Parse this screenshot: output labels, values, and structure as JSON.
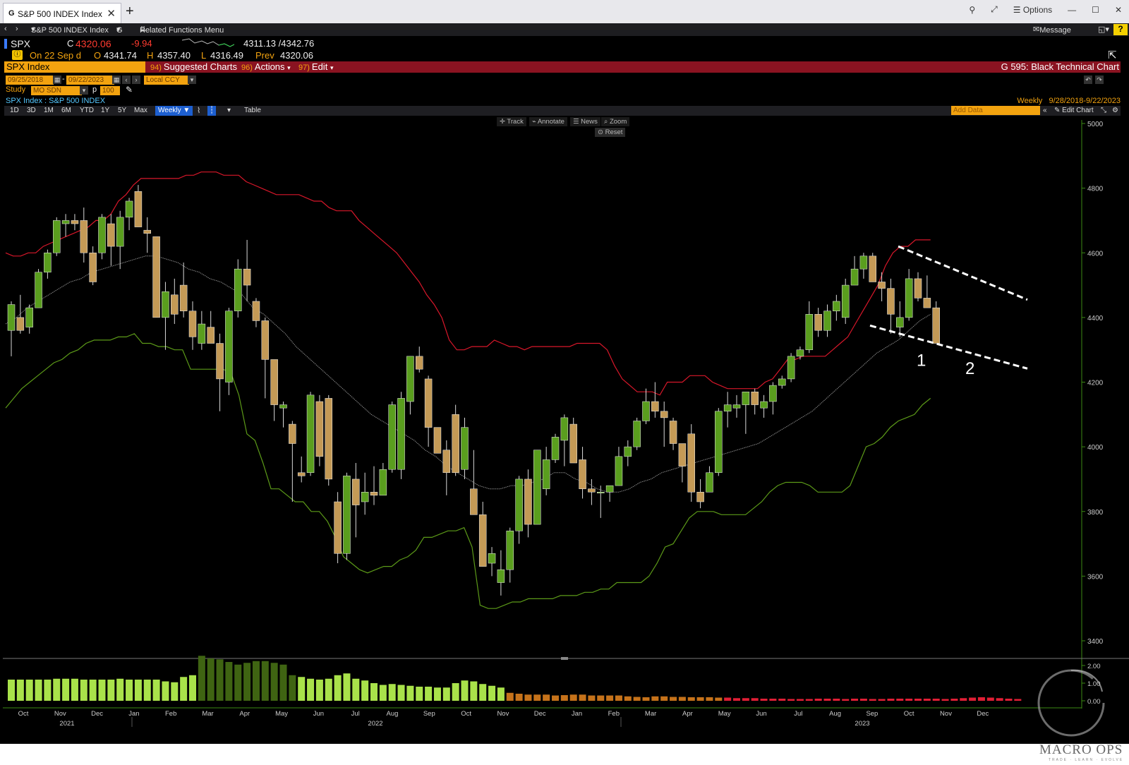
{
  "window": {
    "tab_title": "S&P 500 INDEX Index",
    "tab_prefix": "G",
    "options_label": "Options"
  },
  "navbar": {
    "security": "S&P 500 INDEX Index",
    "g_menu": "G",
    "related": "Related Functions Menu",
    "message": "Message",
    "help": "?"
  },
  "quote": {
    "ticker": "SPX",
    "close_prefix": "C",
    "close": "4320.06",
    "change": "-9.94",
    "range": "4311.13 /4342.76",
    "date_line": "On 22 Sep d",
    "open_prefix": "O",
    "open": "4341.74",
    "high_prefix": "H",
    "high": "4357.40",
    "low_prefix": "L",
    "low": "4316.49",
    "prev_prefix": "Prev",
    "prev": "4320.06"
  },
  "function_bar": {
    "security": "SPX Index",
    "suggested": {
      "num": "94)",
      "label": "Suggested Charts"
    },
    "actions": {
      "num": "96)",
      "label": "Actions"
    },
    "edit": {
      "num": "97)",
      "label": "Edit"
    },
    "chart_name": "G 595: Black Technical Chart"
  },
  "controls": {
    "start_date": "09/25/2018",
    "end_date": "09/22/2023",
    "currency": "Local CCY",
    "study_label": "Study",
    "study_value": "MO SDN",
    "p_label": "p",
    "p_value": "100",
    "chart_title": "SPX Index : S&P 500 INDEX",
    "frequency_label": "Weekly",
    "date_range": "9/28/2018-9/22/2023",
    "periods": [
      "1D",
      "3D",
      "1M",
      "6M",
      "YTD",
      "1Y",
      "5Y",
      "Max"
    ],
    "frequency_button": "Weekly",
    "table_label": "Table",
    "add_data_placeholder": "Add Data",
    "edit_chart": "Edit Chart",
    "tools": [
      "Track",
      "Annotate",
      "News",
      "Zoom"
    ],
    "reset": "Reset"
  },
  "annotations": {
    "label1": "1",
    "label2": "2"
  },
  "branding": {
    "logo_text": "MACRO OPS",
    "logo_sub": "TRADE · LEARN · EVOLVE"
  },
  "chart_data": {
    "type": "candlestick",
    "frequency": "Weekly",
    "y_axis": {
      "ticks": [
        3400,
        3600,
        3800,
        4000,
        4200,
        4400,
        4600,
        4800,
        5000
      ],
      "range": [
        3400,
        5020
      ],
      "side": "right"
    },
    "volume_axis": {
      "ticks": [
        "0.00",
        "1.00",
        "2.00"
      ],
      "range": [
        0,
        2.6
      ]
    },
    "x_axis": {
      "months": [
        "Oct",
        "Nov",
        "Dec",
        "Jan",
        "Feb",
        "Mar",
        "Apr",
        "May",
        "Jun",
        "Jul",
        "Aug",
        "Sep",
        "Oct",
        "Nov",
        "Dec",
        "Jan",
        "Feb",
        "Mar",
        "Apr",
        "May",
        "Jun",
        "Jul",
        "Aug",
        "Sep",
        "Oct",
        "Nov",
        "Dec"
      ],
      "years": [
        "2021",
        "2022",
        "2023"
      ]
    },
    "colors": {
      "up": "#5a9e1e",
      "down": "#c49a56",
      "upper_band": "#d8172a",
      "lower_band": "#5c9a18",
      "mid_line": "#8a8a8a",
      "vol_up": "#a9e24a",
      "vol_up_dark": "#3f6412",
      "vol_orange": "#c5721a",
      "vol_red": "#e01f35",
      "axis": "#3c8a14"
    },
    "candles": [
      [
        4360,
        4450,
        4280,
        4440
      ],
      [
        4400,
        4470,
        4350,
        4360
      ],
      [
        4370,
        4440,
        4350,
        4430
      ],
      [
        4430,
        4550,
        4430,
        4540
      ],
      [
        4540,
        4610,
        4520,
        4600
      ],
      [
        4600,
        4710,
        4590,
        4700
      ],
      [
        4690,
        4720,
        4650,
        4700
      ],
      [
        4700,
        4720,
        4670,
        4690
      ],
      [
        4700,
        4740,
        4570,
        4600
      ],
      [
        4600,
        4620,
        4500,
        4510
      ],
      [
        4600,
        4720,
        4580,
        4710
      ],
      [
        4690,
        4720,
        4560,
        4620
      ],
      [
        4620,
        4730,
        4550,
        4710
      ],
      [
        4710,
        4770,
        4670,
        4760
      ],
      [
        4790,
        4810,
        4680,
        4680
      ],
      [
        4670,
        4710,
        4600,
        4660
      ],
      [
        4650,
        4610,
        4400,
        4400
      ],
      [
        4400,
        4510,
        4300,
        4480
      ],
      [
        4470,
        4520,
        4380,
        4410
      ],
      [
        4500,
        4570,
        4400,
        4420
      ],
      [
        4420,
        4450,
        4300,
        4340
      ],
      [
        4320,
        4420,
        4300,
        4380
      ],
      [
        4370,
        4420,
        4330,
        4320
      ],
      [
        4320,
        4350,
        4110,
        4210
      ],
      [
        4200,
        4430,
        4160,
        4420
      ],
      [
        4420,
        4580,
        4400,
        4550
      ],
      [
        4550,
        4640,
        4450,
        4500
      ],
      [
        4450,
        4460,
        4370,
        4390
      ],
      [
        4390,
        4400,
        4150,
        4270
      ],
      [
        4270,
        4250,
        4080,
        4130
      ],
      [
        4120,
        4140,
        4060,
        4130
      ],
      [
        4070,
        4080,
        3830,
        4010
      ],
      [
        3920,
        3970,
        3890,
        3910
      ],
      [
        3920,
        4170,
        3910,
        4160
      ],
      [
        4140,
        4160,
        3940,
        3970
      ],
      [
        4150,
        4160,
        3880,
        3900
      ],
      [
        3830,
        3860,
        3640,
        3670
      ],
      [
        3670,
        3920,
        3650,
        3910
      ],
      [
        3900,
        3950,
        3720,
        3820
      ],
      [
        3830,
        3920,
        3790,
        3860
      ],
      [
        3860,
        3940,
        3820,
        3850
      ],
      [
        3850,
        3950,
        3850,
        3930
      ],
      [
        3930,
        4140,
        3920,
        4130
      ],
      [
        3930,
        4170,
        3900,
        4150
      ],
      [
        4140,
        4280,
        4100,
        4280
      ],
      [
        4280,
        4310,
        4230,
        4240
      ],
      [
        4210,
        4220,
        4000,
        4060
      ],
      [
        4060,
        4040,
        3990,
        3980
      ],
      [
        3990,
        4020,
        3850,
        3920
      ],
      [
        4100,
        4130,
        3910,
        3920
      ],
      [
        3930,
        4090,
        3900,
        4060
      ],
      [
        3870,
        3990,
        3800,
        3790
      ],
      [
        3790,
        3830,
        3630,
        3630
      ],
      [
        3640,
        3690,
        3600,
        3670
      ],
      [
        3580,
        3680,
        3540,
        3620
      ],
      [
        3620,
        3750,
        3580,
        3740
      ],
      [
        3740,
        3910,
        3700,
        3900
      ],
      [
        3900,
        3930,
        3720,
        3760
      ],
      [
        3760,
        3990,
        3760,
        3990
      ],
      [
        3870,
        4000,
        3850,
        3960
      ],
      [
        3960,
        4040,
        3950,
        4030
      ],
      [
        4020,
        4100,
        3940,
        4090
      ],
      [
        4070,
        4090,
        3980,
        3950
      ],
      [
        3960,
        4000,
        3840,
        3870
      ],
      [
        3870,
        3900,
        3820,
        3860
      ],
      [
        3860,
        3880,
        3780,
        3860
      ],
      [
        3860,
        3870,
        3830,
        3880
      ],
      [
        3880,
        4000,
        3880,
        3970
      ],
      [
        3970,
        4020,
        3940,
        4000
      ],
      [
        4000,
        4090,
        3990,
        4080
      ],
      [
        4080,
        4180,
        4070,
        4140
      ],
      [
        4140,
        4200,
        4090,
        4110
      ],
      [
        4110,
        4140,
        4000,
        4090
      ],
      [
        4080,
        4090,
        3990,
        4010
      ],
      [
        4010,
        3950,
        3890,
        3940
      ],
      [
        4040,
        4070,
        3830,
        3860
      ],
      [
        3860,
        3900,
        3810,
        3830
      ],
      [
        3860,
        3940,
        3860,
        3920
      ],
      [
        3920,
        4120,
        3910,
        4110
      ],
      [
        4110,
        4170,
        4060,
        4130
      ],
      [
        4120,
        4160,
        4090,
        4130
      ],
      [
        4130,
        4170,
        4040,
        4170
      ],
      [
        4170,
        4180,
        4100,
        4130
      ],
      [
        4120,
        4160,
        4090,
        4140
      ],
      [
        4140,
        4200,
        4100,
        4190
      ],
      [
        4190,
        4220,
        4180,
        4210
      ],
      [
        4210,
        4290,
        4200,
        4280
      ],
      [
        4280,
        4310,
        4270,
        4300
      ],
      [
        4300,
        4450,
        4290,
        4410
      ],
      [
        4410,
        4430,
        4340,
        4360
      ],
      [
        4360,
        4440,
        4340,
        4420
      ],
      [
        4420,
        4470,
        4390,
        4450
      ],
      [
        4400,
        4520,
        4380,
        4500
      ],
      [
        4500,
        4590,
        4500,
        4550
      ],
      [
        4550,
        4600,
        4520,
        4590
      ],
      [
        4590,
        4600,
        4510,
        4510
      ],
      [
        4510,
        4540,
        4450,
        4490
      ],
      [
        4490,
        4520,
        4350,
        4410
      ],
      [
        4370,
        4450,
        4340,
        4400
      ],
      [
        4400,
        4550,
        4390,
        4520
      ],
      [
        4520,
        4540,
        4450,
        4460
      ],
      [
        4460,
        4530,
        4440,
        4430
      ],
      [
        4430,
        4450,
        4320,
        4320
      ]
    ],
    "upper_band": [
      4600,
      4590,
      4590,
      4600,
      4600,
      4620,
      4630,
      4640,
      4650,
      4660,
      4670,
      4680,
      4700,
      4700,
      4720,
      4760,
      4780,
      4810,
      4830,
      4830,
      4830,
      4830,
      4830,
      4830,
      4840,
      4840,
      4850,
      4850,
      4850,
      4840,
      4840,
      4840,
      4820,
      4810,
      4800,
      4790,
      4780,
      4780,
      4780,
      4780,
      4770,
      4760,
      4760,
      4740,
      4730,
      4730,
      4730,
      4700,
      4680,
      4660,
      4640,
      4620,
      4600,
      4570,
      4540,
      4510,
      4470,
      4440,
      4400,
      4330,
      4300,
      4300,
      4310,
      4310,
      4310,
      4330,
      4320,
      4310,
      4310,
      4300,
      4310,
      4310,
      4310,
      4310,
      4310,
      4310,
      4320,
      4320,
      4320,
      4320,
      4300,
      4250,
      4210,
      4190,
      4170,
      4170,
      4170,
      4160,
      4200,
      4200,
      4200,
      4220,
      4220,
      4220,
      4200,
      4190,
      4180,
      4180,
      4180,
      4180,
      4180,
      4200,
      4210,
      4240,
      4270,
      4270,
      4280,
      4280,
      4280,
      4280,
      4300,
      4320,
      4340,
      4380,
      4420,
      4460,
      4500,
      4560,
      4600,
      4620,
      4620,
      4640,
      4640,
      4640
    ],
    "lower_band": [
      4120,
      4150,
      4180,
      4200,
      4220,
      4240,
      4260,
      4270,
      4290,
      4300,
      4320,
      4330,
      4330,
      4330,
      4340,
      4340,
      4350,
      4320,
      4320,
      4310,
      4310,
      4300,
      4300,
      4240,
      4240,
      4240,
      4240,
      4240,
      4230,
      4160,
      4040,
      4020,
      3950,
      3870,
      3870,
      3850,
      3830,
      3830,
      3800,
      3800,
      3770,
      3720,
      3660,
      3640,
      3620,
      3610,
      3620,
      3630,
      3630,
      3650,
      3660,
      3680,
      3720,
      3720,
      3730,
      3740,
      3740,
      3750,
      3690,
      3510,
      3500,
      3500,
      3510,
      3520,
      3520,
      3530,
      3530,
      3530,
      3530,
      3540,
      3540,
      3540,
      3550,
      3550,
      3560,
      3560,
      3580,
      3580,
      3580,
      3580,
      3600,
      3640,
      3690,
      3700,
      3740,
      3780,
      3800,
      3800,
      3800,
      3790,
      3790,
      3790,
      3790,
      3810,
      3830,
      3860,
      3880,
      3890,
      3890,
      3890,
      3880,
      3860,
      3860,
      3860,
      3860,
      3880,
      3940,
      4000,
      4010,
      4030,
      4060,
      4080,
      4090,
      4100,
      4130,
      4150
    ],
    "mid_line": [
      4380,
      4400,
      4430,
      4450,
      4470,
      4490,
      4510,
      4520,
      4540,
      4550,
      4560,
      4570,
      4580,
      4590,
      4590,
      4580,
      4570,
      4550,
      4540,
      4520,
      4510,
      4490,
      4470,
      4430,
      4410,
      4380,
      4350,
      4310,
      4280,
      4250,
      4220,
      4190,
      4160,
      4130,
      4100,
      4080,
      4060,
      4040,
      4020,
      3990,
      3970,
      3940,
      3920,
      3900,
      3880,
      3870,
      3870,
      3880,
      3880,
      3890,
      3900,
      3920,
      3920,
      3900,
      3890,
      3870,
      3860,
      3860,
      3870,
      3890,
      3900,
      3920,
      3930,
      3940,
      3950,
      3960,
      3970,
      3980,
      3990,
      4000,
      4010,
      4030,
      4050,
      4070,
      4090,
      4110,
      4140,
      4170,
      4200,
      4230,
      4260,
      4290,
      4310,
      4330,
      4360,
      4390,
      4410
    ],
    "volume": [
      1.2,
      1.2,
      1.2,
      1.2,
      1.2,
      1.25,
      1.25,
      1.25,
      1.2,
      1.2,
      1.2,
      1.2,
      1.25,
      1.2,
      1.2,
      1.2,
      1.2,
      1.1,
      1.05,
      1.35,
      1.45,
      2.55,
      2.4,
      2.35,
      2.2,
      2.05,
      2.15,
      2.25,
      2.25,
      2.15,
      2.05,
      1.45,
      1.35,
      1.25,
      1.2,
      1.25,
      1.45,
      1.55,
      1.25,
      1.15,
      1.0,
      0.9,
      0.95,
      0.9,
      0.85,
      0.8,
      0.8,
      0.75,
      0.75,
      1.0,
      1.15,
      1.1,
      0.95,
      0.85,
      0.75,
      0.45,
      0.4,
      0.35,
      0.35,
      0.35,
      0.3,
      0.32,
      0.35,
      0.35,
      0.3,
      0.3,
      0.3,
      0.3,
      0.25,
      0.22,
      0.2,
      0.25,
      0.25,
      0.22,
      0.22,
      0.2,
      0.2,
      0.2,
      0.18,
      0.18,
      0.15,
      0.15,
      0.15,
      0.12,
      0.12,
      0.12,
      0.1,
      0.1,
      0.1,
      0.12,
      0.12,
      0.12,
      0.1,
      0.12,
      0.12,
      0.1,
      0.1,
      0.12,
      0.12,
      0.12,
      0.12,
      0.12,
      0.12,
      0.1,
      0.12,
      0.15,
      0.18,
      0.2,
      0.18,
      0.15,
      0.12,
      0.1
    ]
  }
}
